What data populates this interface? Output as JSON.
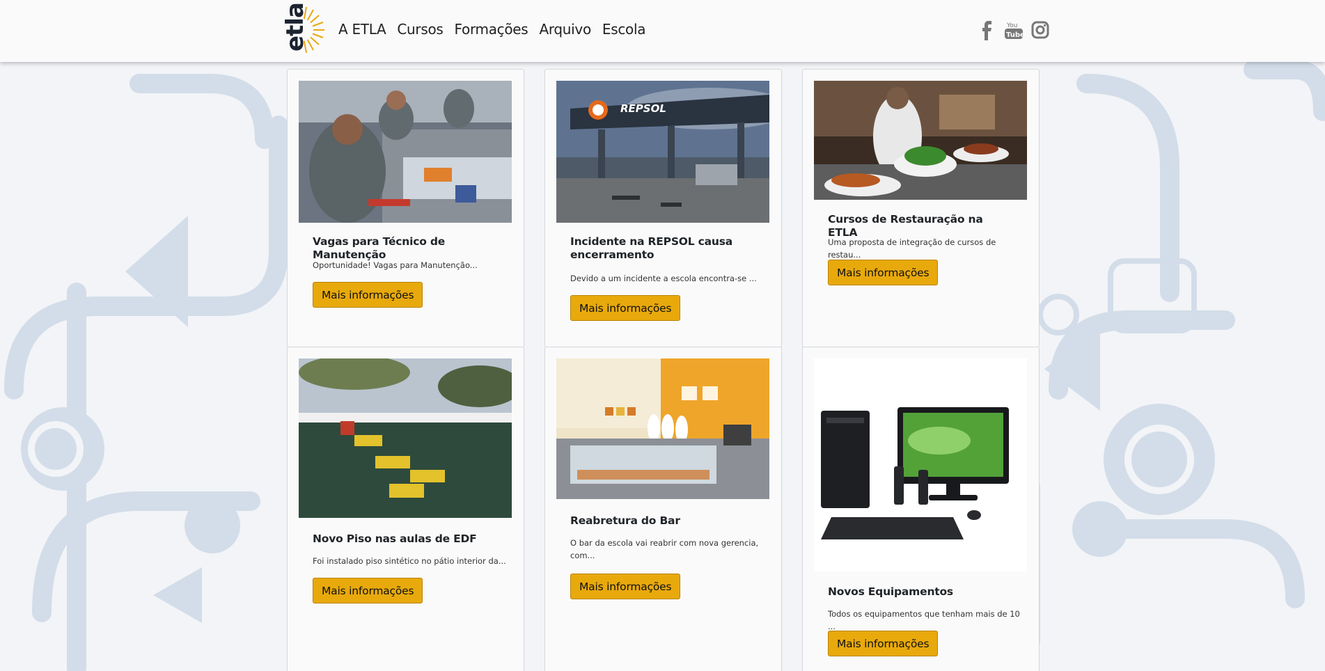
{
  "brand": {
    "logo_text": "etla",
    "accent_color": "#e8a90c"
  },
  "nav": {
    "links": [
      "A ETLA",
      "Cursos",
      "Formações",
      "Arquivo",
      "Escola"
    ]
  },
  "social": [
    "facebook-icon",
    "youtube-icon",
    "instagram-icon"
  ],
  "cards": [
    {
      "title": "Vagas para Técnico de Manutenção",
      "text": "Oportunidade! Vagas para Manutenção...",
      "button": "Mais informações",
      "image": "workshop-photo"
    },
    {
      "title": "Incidente na REPSOL causa encerramento",
      "text": "Devido a um incidente a escola encontra-se ...",
      "button": "Mais informações",
      "image": "repsol-station-photo",
      "image_label": "REPSOL"
    },
    {
      "title": "Cursos de Restauração na ETLA",
      "text": "Uma proposta de integração de cursos de restau...",
      "button": "Mais informações",
      "image": "restaurant-photo"
    },
    {
      "title": "Novo Piso nas aulas de EDF",
      "text": "Foi instalado piso sintético no pátio interior da...",
      "button": "Mais informações",
      "image": "sports-floor-photo"
    },
    {
      "title": "Reabretura do Bar",
      "text": "O bar da escola vai reabrir com nova gerencia, com...",
      "button": "Mais informações",
      "image": "school-bar-photo"
    },
    {
      "title": "Novos Equipamentos",
      "text": "Todos os equipamentos que tenham mais de 10 ...",
      "button": "Mais informações",
      "image": "computer-photo"
    }
  ]
}
